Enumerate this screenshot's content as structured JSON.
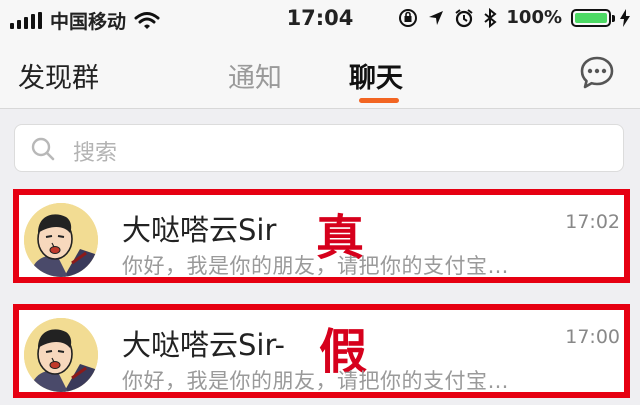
{
  "status_bar": {
    "carrier": "中国移动",
    "time": "17:04",
    "battery_percent": "100%",
    "battery_level": 1.0,
    "icons": [
      "signal-icon",
      "wifi-icon",
      "orientation-lock-icon",
      "location-icon",
      "alarm-icon",
      "bluetooth-icon",
      "battery-icon",
      "charging-icon"
    ]
  },
  "nav": {
    "left_title": "发现群",
    "tabs": [
      {
        "label": "通知",
        "active": false
      },
      {
        "label": "聊天",
        "active": true
      }
    ],
    "accent_color": "#f26522",
    "compose_icon": "chat-bubble-icon"
  },
  "search": {
    "placeholder": "搜索"
  },
  "chats": [
    {
      "name": "大哒嗒云Sir",
      "time": "17:02",
      "preview": "你好，我是你的朋友，请把你的支付宝…",
      "stamp": "真"
    },
    {
      "name": "大哒嗒云Sir-",
      "time": "17:00",
      "preview": "你好，我是你的朋友，请把你的支付宝…",
      "stamp": "假"
    }
  ],
  "colors": {
    "highlight_border": "#e60012",
    "stamp": "#d6001c"
  }
}
